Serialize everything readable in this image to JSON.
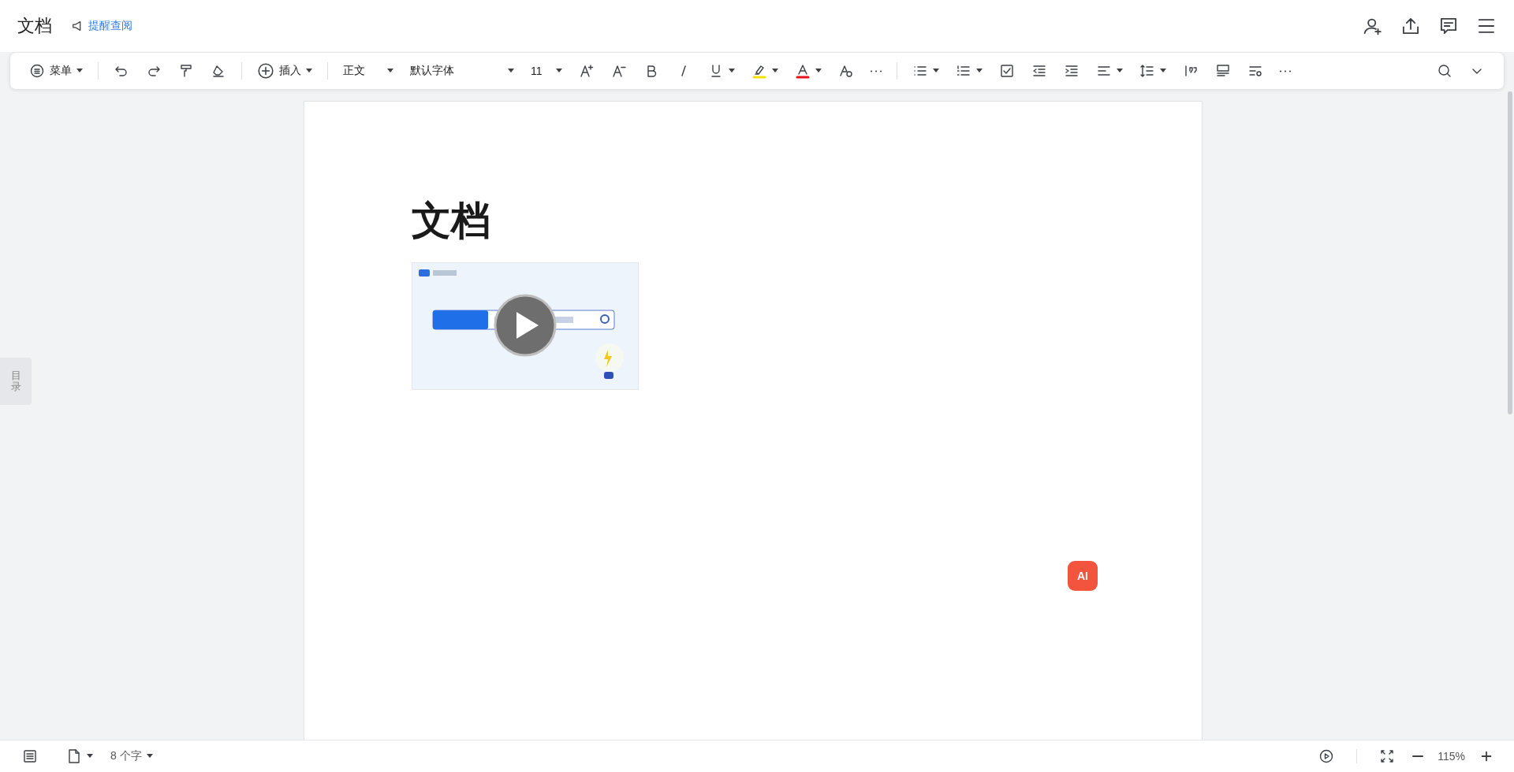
{
  "header": {
    "title": "文档",
    "remind_link": "提醒查阅"
  },
  "toolbar": {
    "menu": "菜单",
    "insert": "插入",
    "paragraph_style": "正文",
    "font": "默认字体",
    "font_size": "11"
  },
  "outline_tab": {
    "label": "目录"
  },
  "document": {
    "heading": "文档",
    "ai_button": {
      "label": "AI"
    }
  },
  "status_bar": {
    "word_count": "8 个字",
    "zoom": "115%"
  }
}
